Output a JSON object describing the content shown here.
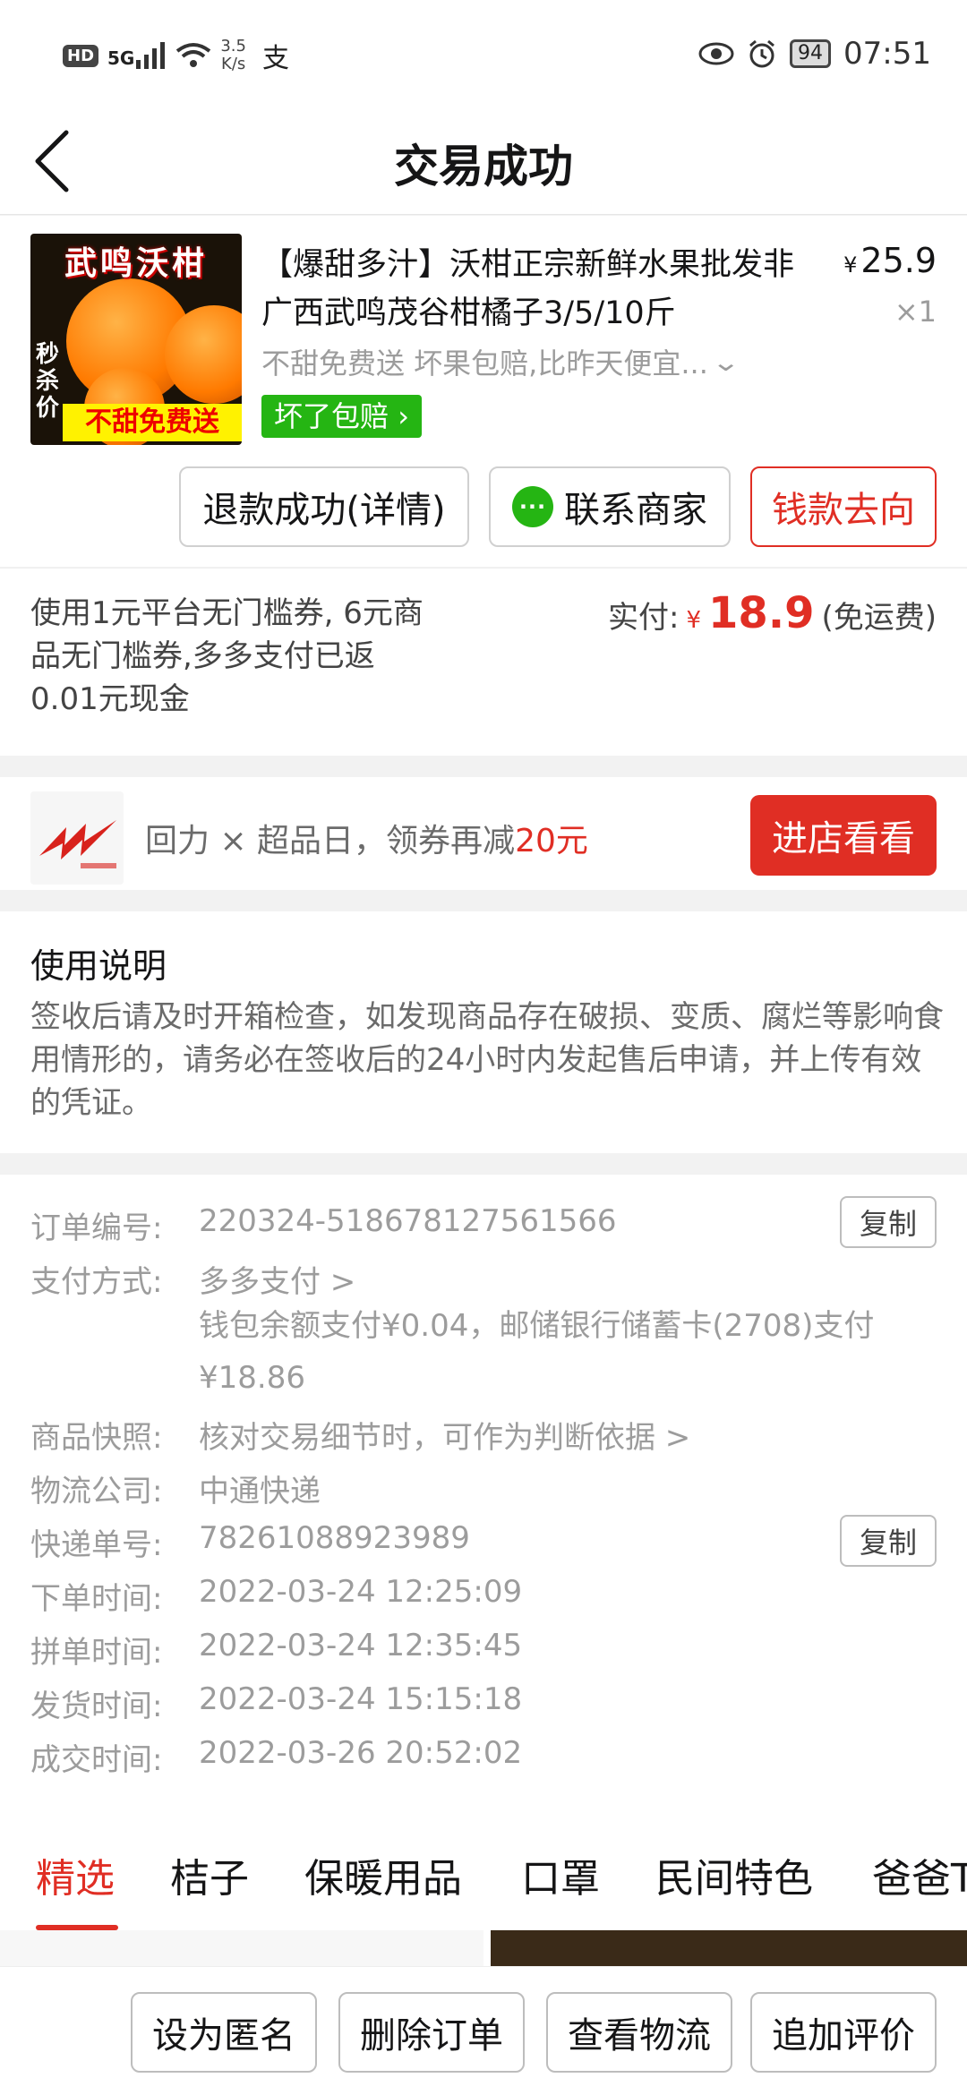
{
  "status_bar": {
    "hd": "HD",
    "signal": "5G",
    "net_speed_value": "3.5",
    "net_speed_unit": "K/s",
    "extra_icon": "支",
    "battery": "94",
    "time": "07:51"
  },
  "nav": {
    "title": "交易成功"
  },
  "product": {
    "image_top_text": "武鸣沃柑",
    "image_side_text": "秒杀价",
    "image_bottom_text": "不甜免费送",
    "title": "【爆甜多汁】沃柑正宗新鲜水果批发非广西武鸣茂谷柑橘子3/5/10斤",
    "price_currency": "¥",
    "price": "25.9",
    "quantity": "×1",
    "spec": "不甜免费送 坏果包赔,比昨天便宜...",
    "badge": "坏了包赔"
  },
  "actions": {
    "refund": "退款成功(详情)",
    "contact": "联系商家",
    "money_flow": "钱款去向"
  },
  "payment": {
    "desc": "使用1元平台无门槛券, 6元商品无门槛券,多多支付已返0.01元现金",
    "paid_label": "实付:",
    "currency": "¥",
    "amount": "18.9",
    "shipping": "(免运费)"
  },
  "promo": {
    "text_prefix": "回力 × 超品日，领券再减",
    "text_highlight": "20元",
    "button": "进店看看"
  },
  "usage": {
    "title": "使用说明",
    "body": "签收后请及时开箱检查，如发现商品存在破损、变质、腐烂等影响食用情形的，请务必在签收后的24小时内发起售后申请，并上传有效的凭证。"
  },
  "order_info": {
    "order_no_label": "订单编号:",
    "order_no": "220324-518678127561566",
    "copy": "复制",
    "pay_method_label": "支付方式:",
    "pay_method": "多多支付 >",
    "pay_detail_line1": "钱包余额支付¥0.04，邮储银行储蓄卡(2708)支付",
    "pay_detail_line2": "¥18.86",
    "snapshot_label": "商品快照:",
    "snapshot": "核对交易细节时，可作为判断依据 >",
    "logistics_label": "物流公司:",
    "logistics": "中通快递",
    "tracking_label": "快递单号:",
    "tracking": "78261088923989",
    "order_time_label": "下单时间:",
    "order_time": "2022-03-24 12:25:09",
    "group_time_label": "拼单时间:",
    "group_time": "2022-03-24 12:35:45",
    "ship_time_label": "发货时间:",
    "ship_time": "2022-03-24 15:15:18",
    "deal_time_label": "成交时间:",
    "deal_time": "2022-03-26 20:52:02"
  },
  "tabs": [
    "精选",
    "桔子",
    "保暖用品",
    "口罩",
    "民间特色",
    "爸爸T"
  ],
  "bottom": {
    "anonymous": "设为匿名",
    "delete": "删除订单",
    "logistics": "查看物流",
    "review": "追加评价"
  },
  "colors": {
    "accent_red": "#e02e24",
    "badge_green": "#25b513"
  }
}
